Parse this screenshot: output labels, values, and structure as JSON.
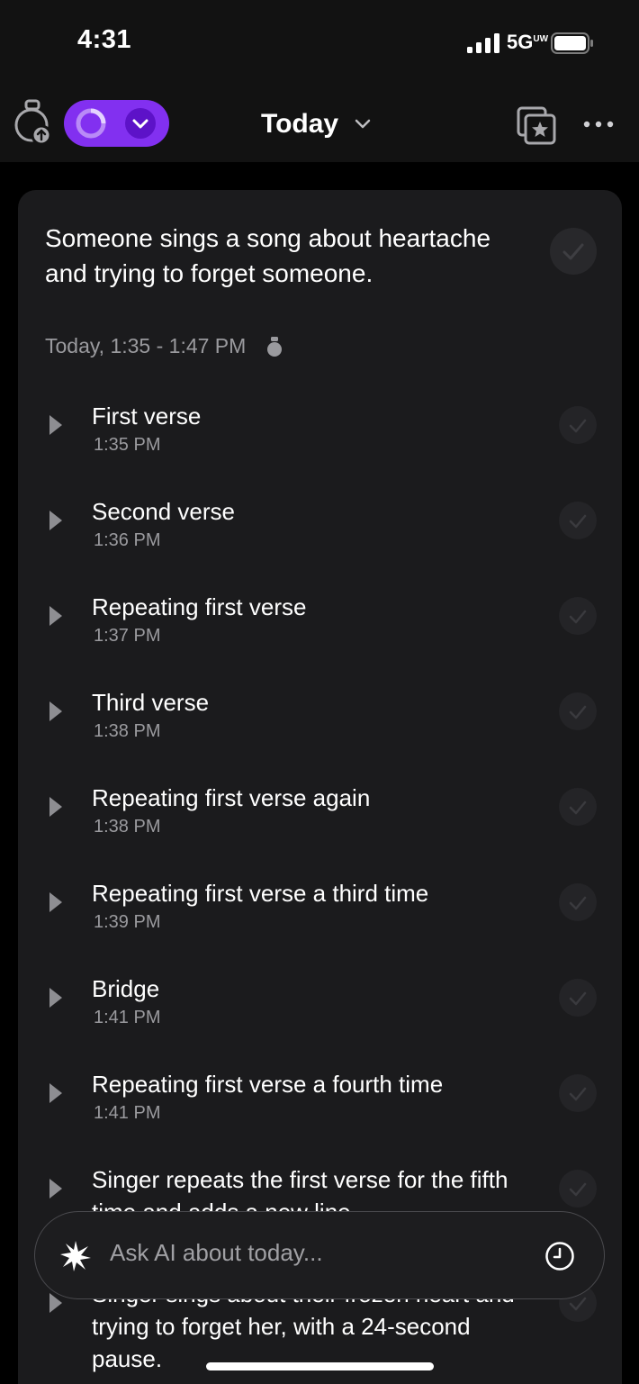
{
  "status_bar": {
    "time": "4:31",
    "network": "5G",
    "network_sup": "UW"
  },
  "header": {
    "title": "Today",
    "icons": [
      "device-upload-icon",
      "sync-ring-icon",
      "chevron-down-icon",
      "starred-collection-icon",
      "more-icon"
    ],
    "accent_color": "#8230f0"
  },
  "summary": {
    "text": "Someone sings a song about heartache and trying to forget someone.",
    "meta": "Today, 1:35 - 1:47 PM"
  },
  "items": [
    {
      "label": "First verse",
      "time": "1:35 PM"
    },
    {
      "label": "Second verse",
      "time": "1:36 PM"
    },
    {
      "label": "Repeating first verse",
      "time": "1:37 PM"
    },
    {
      "label": "Third verse",
      "time": "1:38 PM"
    },
    {
      "label": "Repeating first verse again",
      "time": "1:38 PM"
    },
    {
      "label": "Repeating first verse a third time",
      "time": "1:39 PM"
    },
    {
      "label": "Bridge",
      "time": "1:41 PM"
    },
    {
      "label": "Repeating first verse a fourth time",
      "time": "1:41 PM"
    },
    {
      "label": "Singer repeats the first verse for the fifth time and adds a new line",
      "time": ""
    },
    {
      "label": "Singer sings about their frozen heart and trying to forget her, with a 24-second pause.",
      "time": ""
    }
  ],
  "ask_bar": {
    "placeholder": "Ask AI about today..."
  }
}
